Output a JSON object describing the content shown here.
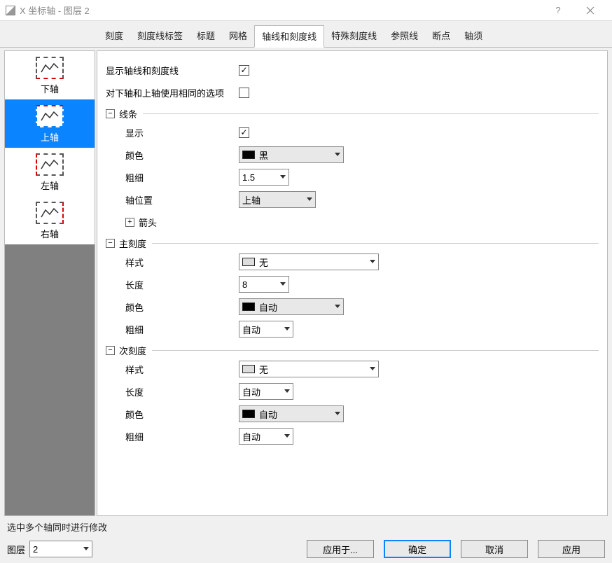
{
  "window": {
    "title": "X 坐标轴 - 图层 2"
  },
  "tabs": {
    "t0": "刻度",
    "t1": "刻度线标签",
    "t2": "标题",
    "t3": "网格",
    "t4": "轴线和刻度线",
    "t5": "特殊刻度线",
    "t6": "参照线",
    "t7": "断点",
    "t8": "轴须"
  },
  "sidebar": {
    "bottom": "下轴",
    "top": "上轴",
    "left": "左轴",
    "right": "右轴"
  },
  "form": {
    "show_axis_ticks": "显示轴线和刻度线",
    "same_top_bottom": "对下轴和上轴使用相同的选项",
    "section_line": "线条",
    "show": "显示",
    "color": "颜色",
    "thickness": "粗细",
    "axis_pos": "轴位置",
    "arrow": "箭头",
    "section_major": "主刻度",
    "style": "样式",
    "length": "长度",
    "section_minor": "次刻度",
    "val_black": "黑",
    "val_15": "1.5",
    "val_top_axis": "上轴",
    "val_none": "无",
    "val_8": "8",
    "val_auto": "自动"
  },
  "footer": {
    "hint": "选中多个轴同时进行修改",
    "layer_label": "图层",
    "layer_value": "2",
    "apply_to": "应用于...",
    "ok": "确定",
    "cancel": "取消",
    "apply": "应用"
  }
}
